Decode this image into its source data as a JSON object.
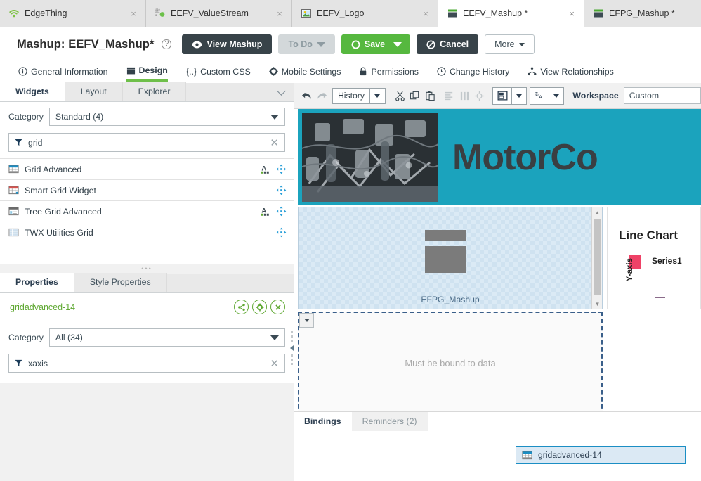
{
  "browser_tabs": [
    {
      "label": "EdgeThing",
      "icon": "wifi-thing-icon",
      "active": false,
      "close": "×"
    },
    {
      "label": "EEFV_ValueStream",
      "icon": "valuestream-icon",
      "active": false,
      "close": "×"
    },
    {
      "label": "EEFV_Logo",
      "icon": "image-media-icon",
      "active": false,
      "close": "×"
    },
    {
      "label": "EEFV_Mashup *",
      "icon": "mashup-icon",
      "active": true,
      "close": "×"
    },
    {
      "label": "EFPG_Mashup *",
      "icon": "mashup-icon",
      "active": false,
      "close": "×"
    }
  ],
  "header": {
    "title_prefix": "Mashup: ",
    "entity_name": "EEFV_Mashup",
    "dirty_marker": "*",
    "help_glyph": "?",
    "view_mashup_label": "View Mashup",
    "todo_label": "To Do",
    "save_label": "Save",
    "cancel_label": "Cancel",
    "more_label": "More"
  },
  "subnav": [
    {
      "label": "General Information",
      "icon": "info-icon",
      "active": false
    },
    {
      "label": "Design",
      "icon": "design-icon",
      "active": true
    },
    {
      "label": "Custom CSS",
      "icon": "braces-icon",
      "active": false
    },
    {
      "label": "Mobile Settings",
      "icon": "gear-icon",
      "active": false
    },
    {
      "label": "Permissions",
      "icon": "lock-icon",
      "active": false
    },
    {
      "label": "Change History",
      "icon": "clock-icon",
      "active": false
    },
    {
      "label": "View Relationships",
      "icon": "relationships-icon",
      "active": false
    }
  ],
  "widgets_panel": {
    "tabs": [
      {
        "label": "Widgets",
        "active": true
      },
      {
        "label": "Layout",
        "active": false
      },
      {
        "label": "Explorer",
        "active": false
      }
    ],
    "category_label": "Category",
    "category_value": "Standard (4)",
    "filter_value": "grid",
    "filter_placeholder": "",
    "clear_glyph": "✕",
    "items": [
      {
        "label": "Grid Advanced",
        "icon": "grid-advanced-icon",
        "has_localization": true,
        "has_move": true
      },
      {
        "label": "Smart Grid Widget",
        "icon": "smart-grid-icon",
        "has_localization": false,
        "has_move": true
      },
      {
        "label": "Tree Grid Advanced",
        "icon": "tree-grid-icon",
        "has_localization": true,
        "has_move": true
      },
      {
        "label": "TWX Utilities Grid",
        "icon": "utilities-grid-icon",
        "has_localization": false,
        "has_move": true
      }
    ]
  },
  "properties_panel": {
    "tabs": [
      {
        "label": "Properties",
        "active": true
      },
      {
        "label": "Style Properties",
        "active": false
      }
    ],
    "selected_widget": "gridadvanced-14",
    "actions": [
      {
        "name": "share-icon"
      },
      {
        "name": "gear-icon"
      },
      {
        "name": "close-icon"
      }
    ],
    "category_label": "Category",
    "category_value": "All (34)",
    "filter_value": "xaxis",
    "clear_glyph": "✕"
  },
  "canvas_toolbar": {
    "undo": "undo-icon",
    "redo": "redo-icon",
    "history_label": "History",
    "cut": "cut-icon",
    "copy": "copy-icon",
    "paste": "paste-icon",
    "align": "align-icon",
    "distribute": "distribute-icon",
    "target": "target-icon",
    "layout_view": "layout-view-icon",
    "localization": "localization-icon",
    "workspace_label": "Workspace",
    "workspace_value": "Custom"
  },
  "canvas": {
    "banner_title": "MotorCo",
    "banner_color": "#1ba3bd",
    "banner_image_alt": "engine-photo",
    "contained_mashup_label": "EFPG_Mashup",
    "grid_widget_message": "Must be bound to data"
  },
  "chart_data": {
    "type": "line",
    "title": "Line Chart",
    "xlabel": "",
    "ylabel": "Y-axis",
    "series": [
      {
        "name": "Series1",
        "color": "#ef4267",
        "values": []
      }
    ],
    "legend_position": "top-left",
    "grid": false,
    "note": "placeholder line chart widget, no data points rendered"
  },
  "bindings_panel": {
    "tabs": [
      {
        "label": "Bindings",
        "active": true
      },
      {
        "label": "Reminders (2)",
        "active": false
      }
    ],
    "chip_label": "gridadvanced-14",
    "chip_icon": "grid-advanced-icon"
  },
  "colors": {
    "accent_teal": "#1ba3bd",
    "save_green": "#56b83f",
    "dark_button": "#384349",
    "selection_blue": "#1b8ec4",
    "series1_pink": "#ef4267",
    "property_green": "#5fa832"
  }
}
